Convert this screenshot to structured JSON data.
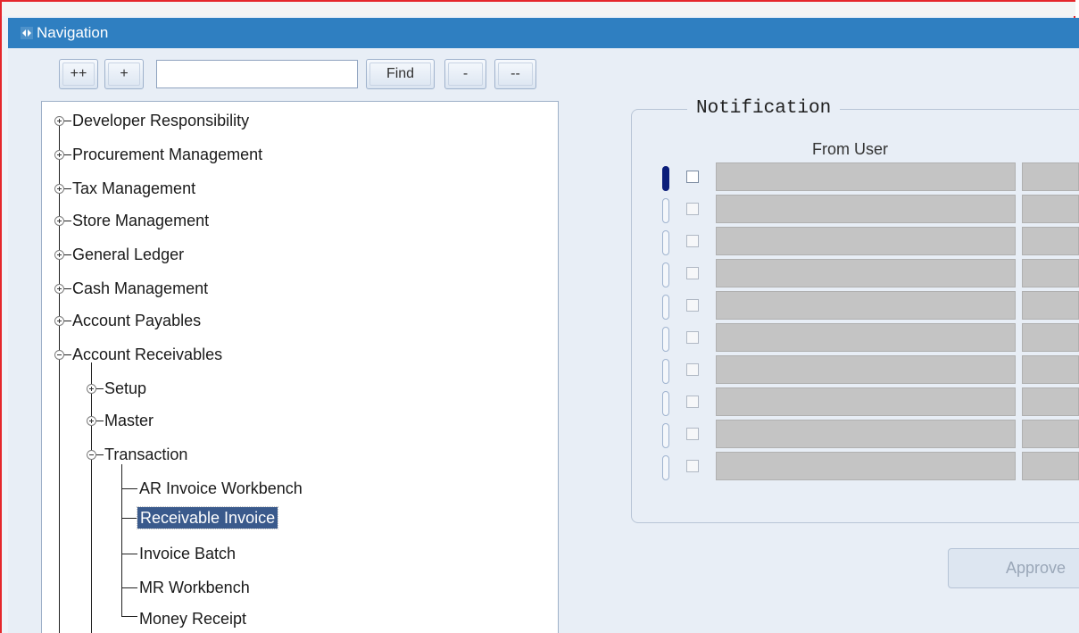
{
  "window": {
    "title": "Navigation"
  },
  "toolbar": {
    "expand_all": "++",
    "expand": "+",
    "find_value": "",
    "find_label": "Find",
    "collapse": "-",
    "collapse_all": "--"
  },
  "tree": {
    "items": [
      {
        "label": "Developer Responsibility",
        "state": "collapsed"
      },
      {
        "label": "Procurement Management",
        "state": "collapsed"
      },
      {
        "label": "Tax Management",
        "state": "collapsed"
      },
      {
        "label": "Store Management",
        "state": "collapsed"
      },
      {
        "label": "General Ledger",
        "state": "collapsed"
      },
      {
        "label": "Cash Management",
        "state": "collapsed"
      },
      {
        "label": "Account Payables",
        "state": "collapsed"
      },
      {
        "label": "Account Receivables",
        "state": "expanded"
      },
      {
        "label": "Setup",
        "state": "collapsed"
      },
      {
        "label": "Master",
        "state": "collapsed"
      },
      {
        "label": "Transaction",
        "state": "expanded"
      },
      {
        "label": "AR Invoice Workbench",
        "state": "leaf"
      },
      {
        "label": "Receivable Invoice",
        "state": "leaf",
        "selected": true
      },
      {
        "label": "Invoice Batch",
        "state": "leaf"
      },
      {
        "label": "MR Workbench",
        "state": "leaf"
      },
      {
        "label": "Money Receipt",
        "state": "leaf"
      }
    ]
  },
  "notification": {
    "title": "Notification",
    "column_from_user": "From User",
    "row_count": 10,
    "approve_label": "Approve"
  },
  "colors": {
    "titlebar": "#2f7fc1",
    "selection": "#3a5a8c",
    "frame_border": "#e5262b"
  }
}
